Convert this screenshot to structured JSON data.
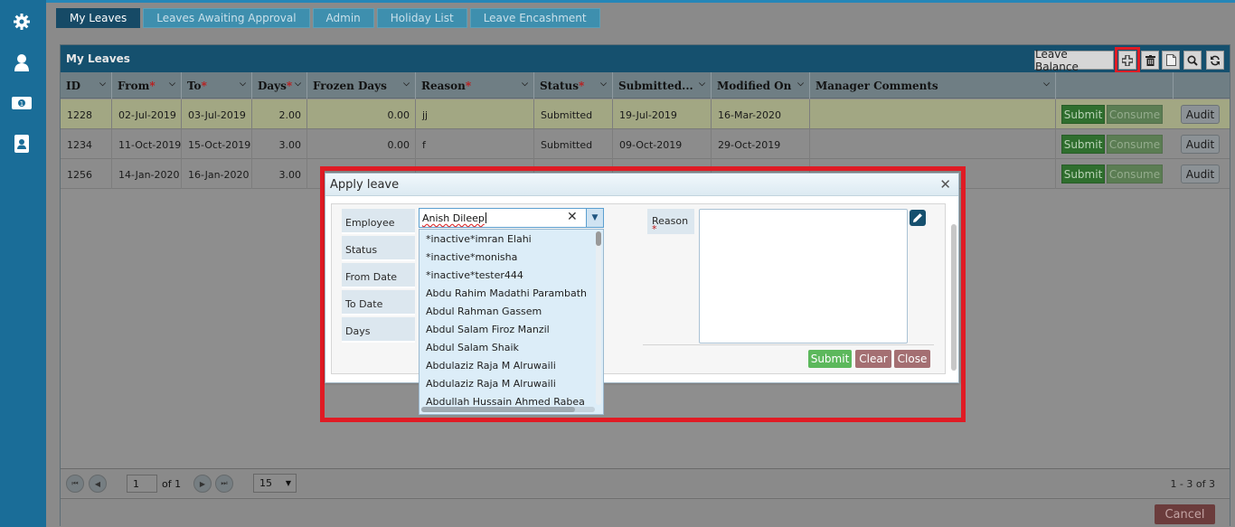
{
  "nav": [
    "settings-icon",
    "user-icon",
    "money-icon",
    "contacts-icon"
  ],
  "tabs": [
    "My Leaves",
    "Leaves Awaiting Approval",
    "Admin",
    "Holiday List",
    "Leave Encashment"
  ],
  "panel": {
    "title": "My Leaves",
    "leave_balance": "Leave Balance"
  },
  "grid": {
    "columns": [
      {
        "label": "ID",
        "required": ""
      },
      {
        "label": "From",
        "required": "*"
      },
      {
        "label": "To",
        "required": "*"
      },
      {
        "label": "Days",
        "required": "*"
      },
      {
        "label": "Frozen Days",
        "required": ""
      },
      {
        "label": "Reason",
        "required": "*"
      },
      {
        "label": "Status",
        "required": "*"
      },
      {
        "label": "Submitted...",
        "required": ""
      },
      {
        "label": "Modified On",
        "required": ""
      },
      {
        "label": "Manager Comments",
        "required": ""
      }
    ],
    "rows": [
      {
        "id": "1228",
        "from": "02-Jul-2019",
        "to": "03-Jul-2019",
        "days": "2.00",
        "frozen": "0.00",
        "reason": "jj",
        "status": "Submitted",
        "submitted": "19-Jul-2019",
        "modified": "16-Mar-2020",
        "comments": ""
      },
      {
        "id": "1234",
        "from": "11-Oct-2019",
        "to": "15-Oct-2019",
        "days": "3.00",
        "frozen": "0.00",
        "reason": "f",
        "status": "Submitted",
        "submitted": "09-Oct-2019",
        "modified": "29-Oct-2019",
        "comments": ""
      },
      {
        "id": "1256",
        "from": "14-Jan-2020",
        "to": "16-Jan-2020",
        "days": "3.00",
        "frozen": "",
        "reason": "",
        "status": "",
        "submitted": "",
        "modified": "",
        "comments": ""
      }
    ],
    "submit_label": "Submit",
    "consume_label": "Consume",
    "audit_label": "Audit"
  },
  "pager": {
    "page": "1",
    "of_label": "of 1",
    "page_size": "15",
    "count": "1 - 3 of 3"
  },
  "cancel_label": "Cancel",
  "dialog": {
    "title": "Apply leave",
    "labels": {
      "employee": "Employee",
      "status": "Status",
      "from_date": "From Date",
      "to_date": "To Date",
      "days": "Days",
      "reason": "Reason",
      "reason_req": "*"
    },
    "employee_value": "Anish Dileep",
    "employee_options": [
      "*inactive*imran Elahi",
      "*inactive*monisha",
      "*inactive*tester444",
      "Abdu Rahim Madathi Parambath",
      "Abdul Rahman Gassem",
      "Abdul Salam Firoz Manzil",
      "Abdul Salam Shaik",
      "Abdulaziz Raja M Alruwaili",
      "Abdulaziz Raja M Alruwaili",
      "Abdullah Hussain Ahmed Rabea"
    ],
    "submit": "Submit",
    "clear": "Clear",
    "close": "Close"
  }
}
